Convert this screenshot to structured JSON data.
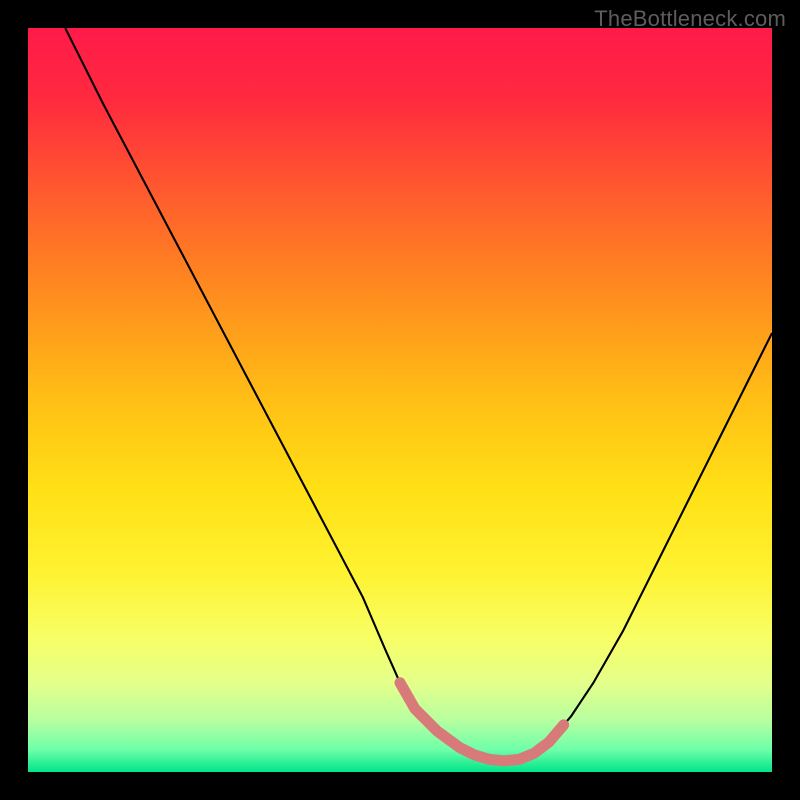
{
  "watermark": "TheBottleneck.com",
  "chart_data": {
    "type": "line",
    "title": "",
    "xlabel": "",
    "ylabel": "",
    "xlim": [
      0,
      100
    ],
    "ylim": [
      0,
      100
    ],
    "series": [
      {
        "name": "curve",
        "x": [
          5,
          10,
          15,
          20,
          25,
          30,
          35,
          40,
          45,
          48,
          50,
          52,
          55,
          58,
          60,
          62,
          64,
          66,
          68,
          70,
          73,
          76,
          80,
          85,
          90,
          95,
          100
        ],
        "y": [
          100,
          90,
          80.5,
          71,
          61.5,
          52,
          42.5,
          33,
          23.5,
          16.5,
          12,
          8.5,
          5.5,
          3.3,
          2.3,
          1.7,
          1.5,
          1.7,
          2.5,
          4,
          7.5,
          12,
          19,
          29,
          39,
          49,
          59
        ]
      }
    ],
    "highlight_band": {
      "x_start": 50,
      "x_end": 72,
      "color": "#d97a7a"
    },
    "background_gradient": {
      "stops": [
        {
          "offset": 0.0,
          "color": "#ff1a4a"
        },
        {
          "offset": 0.1,
          "color": "#ff2b3e"
        },
        {
          "offset": 0.22,
          "color": "#ff5a2e"
        },
        {
          "offset": 0.35,
          "color": "#ff8a1f"
        },
        {
          "offset": 0.5,
          "color": "#ffbf15"
        },
        {
          "offset": 0.62,
          "color": "#ffe015"
        },
        {
          "offset": 0.73,
          "color": "#fff230"
        },
        {
          "offset": 0.82,
          "color": "#f7ff66"
        },
        {
          "offset": 0.88,
          "color": "#e4ff8a"
        },
        {
          "offset": 0.93,
          "color": "#b8ffa0"
        },
        {
          "offset": 0.97,
          "color": "#6effa8"
        },
        {
          "offset": 1.0,
          "color": "#00e58a"
        }
      ]
    }
  }
}
